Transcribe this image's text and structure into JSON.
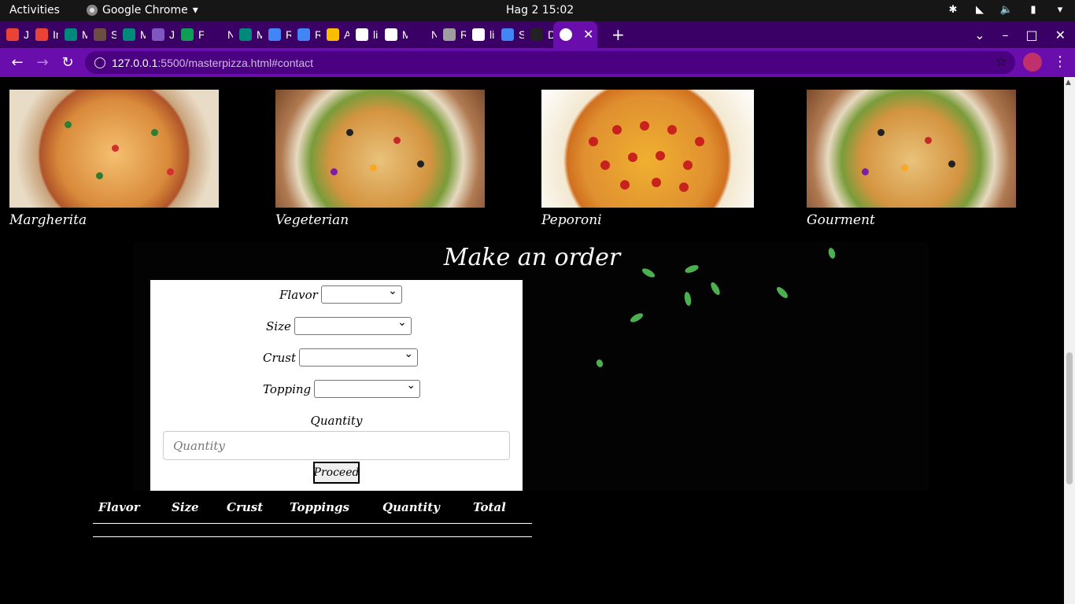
{
  "system": {
    "activities": "Activities",
    "app_name": "Google Chrome",
    "clock": "Hag 2  15:02"
  },
  "tabs": [
    {
      "label": "Ju",
      "color": "#ea4335"
    },
    {
      "label": "Inv",
      "color": "#ea4335"
    },
    {
      "label": "Me",
      "color": "#00897b"
    },
    {
      "label": "SD",
      "color": "#6d4c41"
    },
    {
      "label": "Me",
      "color": "#00897b"
    },
    {
      "label": "Ju",
      "color": "#7e57c2"
    },
    {
      "label": "Pr",
      "color": "#0f9d58"
    },
    {
      "label": "New T",
      "color": "#3b0066"
    },
    {
      "label": "Me",
      "color": "#00897b"
    },
    {
      "label": "RC",
      "color": "#4285f4"
    },
    {
      "label": "RC",
      "color": "#4285f4"
    },
    {
      "label": "Ac",
      "color": "#fbbc04"
    },
    {
      "label": "list",
      "color": "#ffffff"
    },
    {
      "label": "Ma",
      "color": "#ffffff"
    },
    {
      "label": "New T",
      "color": "#3b0066"
    },
    {
      "label": "Ro",
      "color": "#9e9e9e"
    },
    {
      "label": "list",
      "color": "#ffffff"
    },
    {
      "label": "Sa",
      "color": "#4285f4"
    },
    {
      "label": "De",
      "color": "#222222"
    }
  ],
  "browser": {
    "url_host": "127.0.0.1",
    "url_path": ":5500/masterpizza.html#contact"
  },
  "menu": {
    "items": [
      "Margherita",
      "Vegeterian",
      "Peporoni",
      "Gourment"
    ]
  },
  "order": {
    "title": "Make an order",
    "flavor_label": "Flavor",
    "size_label": "Size",
    "crust_label": "Crust",
    "topping_label": "Topping",
    "quantity_label": "Quantity",
    "quantity_placeholder": "Quantity",
    "proceed_label": "Proceed"
  },
  "summary_table": {
    "headers": [
      "Flavor",
      "Size",
      "Crust",
      "Toppings",
      "Quantity",
      "Total"
    ]
  }
}
